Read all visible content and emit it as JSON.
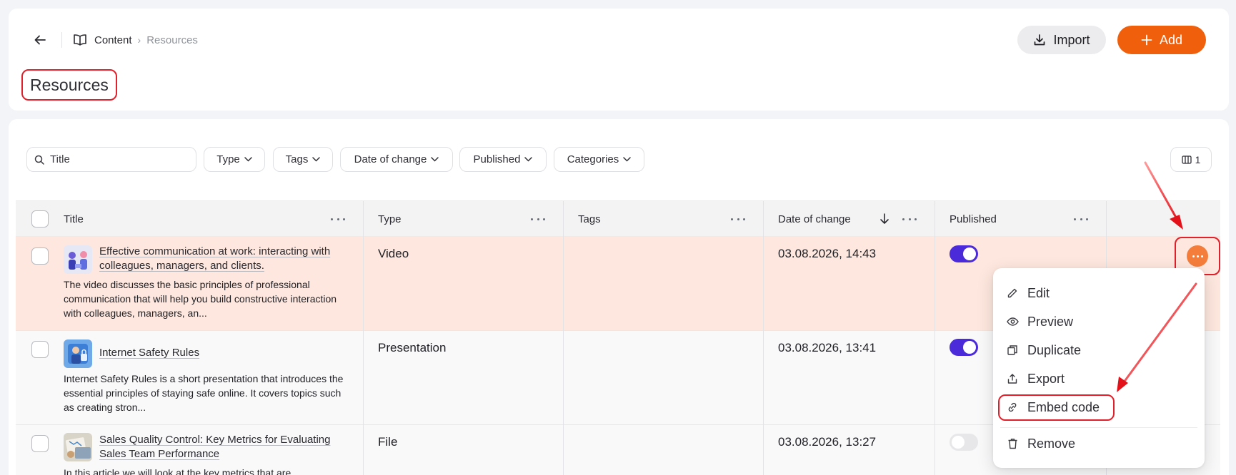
{
  "header": {
    "breadcrumb": {
      "section": "Content",
      "separator": "›",
      "current": "Resources"
    },
    "title": "Resources",
    "import_label": "Import",
    "add_label": "Add"
  },
  "filters": {
    "search_placeholder": "Title",
    "type": "Type",
    "tags": "Tags",
    "date_of_change": "Date of change",
    "published": "Published",
    "categories": "Categories",
    "columns_count": "1"
  },
  "table": {
    "columns": [
      "Title",
      "Type",
      "Tags",
      "Date of change",
      "Published"
    ],
    "rows": [
      {
        "title": "Effective communication at work: interacting with colleagues, managers, and clients.",
        "description": "The video discusses the basic principles of professional communication that will help you build constructive interaction with colleagues, managers, an...",
        "type": "Video",
        "tags": "",
        "date": "03.08.2026, 14:43",
        "published": true
      },
      {
        "title": "Internet Safety Rules",
        "description": "Internet Safety Rules is a short presentation that introduces the essential principles of staying safe online. It covers topics such as creating stron...",
        "type": "Presentation",
        "tags": "",
        "date": "03.08.2026, 13:41",
        "published": true
      },
      {
        "title": "Sales Quality Control: Key Metrics for Evaluating Sales Team Performance",
        "description": "In this article we will look at the key metrics that are",
        "type": "File",
        "tags": "",
        "date": "03.08.2026, 13:27",
        "published": false
      }
    ]
  },
  "context_menu": {
    "items": [
      "Edit",
      "Preview",
      "Duplicate",
      "Export",
      "Embed code",
      "Remove"
    ]
  },
  "colors": {
    "accent": "#f0600c",
    "toggle_on": "#4b2bd9",
    "highlight": "#e0202a",
    "active_row": "#fde7de"
  },
  "icons": [
    "back-arrow-icon",
    "book-icon",
    "download-icon",
    "plus-icon",
    "search-icon",
    "chevron-down-icon",
    "columns-icon",
    "more-icon",
    "sort-down-icon",
    "pencil-icon",
    "eye-icon",
    "duplicate-icon",
    "export-icon",
    "link-icon",
    "trash-icon"
  ]
}
